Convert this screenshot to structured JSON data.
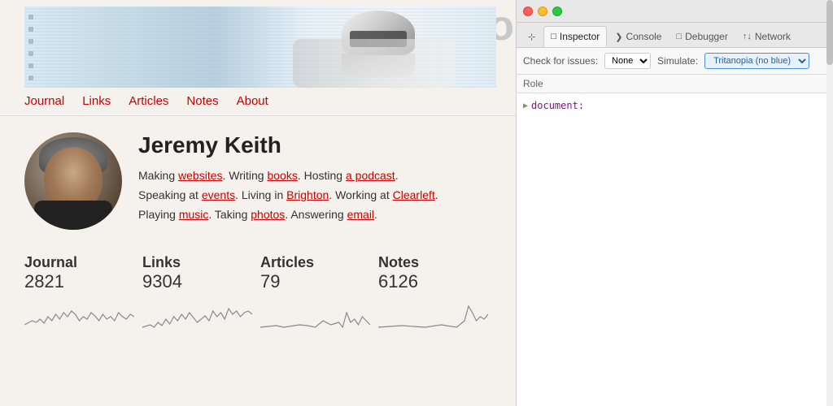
{
  "site": {
    "logo": "adactio",
    "nav": {
      "items": [
        {
          "label": "Journal",
          "href": "#"
        },
        {
          "label": "Links",
          "href": "#"
        },
        {
          "label": "Articles",
          "href": "#"
        },
        {
          "label": "Notes",
          "href": "#"
        },
        {
          "label": "About",
          "href": "#"
        }
      ]
    }
  },
  "profile": {
    "name": "Jeremy Keith",
    "bio_parts": [
      {
        "text": "Making "
      },
      {
        "text": "websites",
        "link": true
      },
      {
        "text": ". Writing "
      },
      {
        "text": "books",
        "link": true
      },
      {
        "text": ". Hosting "
      },
      {
        "text": "a podcast",
        "link": true
      },
      {
        "text": ". Speaking at "
      },
      {
        "text": "events",
        "link": true
      },
      {
        "text": ". Living in "
      },
      {
        "text": "Brighton",
        "link": true
      },
      {
        "text": ". Working at "
      },
      {
        "text": "Clearleft",
        "link": true
      },
      {
        "text": ". Playing "
      },
      {
        "text": "music",
        "link": true
      },
      {
        "text": ". Taking "
      },
      {
        "text": "photos",
        "link": true
      },
      {
        "text": ". Answering "
      },
      {
        "text": "email",
        "link": true
      },
      {
        "text": "."
      }
    ]
  },
  "stats": [
    {
      "label": "Journal",
      "value": "2821"
    },
    {
      "label": "Links",
      "value": "9304"
    },
    {
      "label": "Articles",
      "value": "79"
    },
    {
      "label": "Notes",
      "value": "6126"
    }
  ],
  "devtools": {
    "tabs": [
      {
        "label": "Inspector",
        "icon": "□",
        "active": true
      },
      {
        "label": "Console",
        "icon": "❯",
        "active": false
      },
      {
        "label": "Debugger",
        "icon": "□",
        "active": false
      },
      {
        "label": "Network",
        "icon": "↑↓",
        "active": false
      }
    ],
    "toolbar": {
      "check_issues_label": "Check for issues:",
      "check_issues_value": "None",
      "simulate_label": "Simulate:",
      "simulate_value": "Tritanopia (no blue)"
    },
    "role_label": "Role",
    "tree_item": "document:"
  },
  "colors": {
    "accent": "#cc0000",
    "devtools_bg": "#f0f0f0"
  }
}
